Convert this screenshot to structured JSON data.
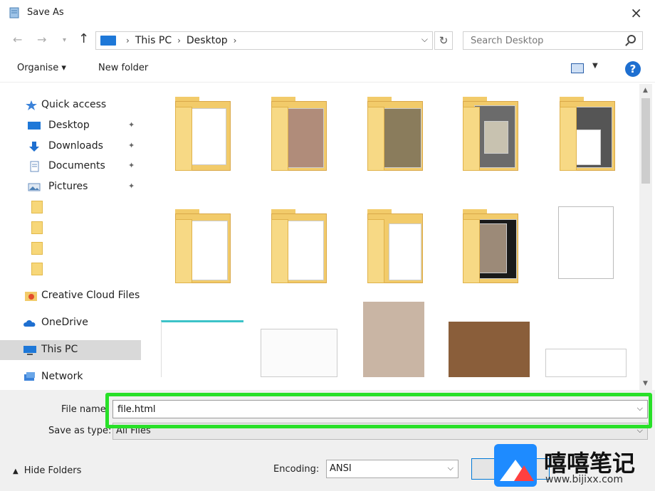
{
  "window": {
    "title": "Save As",
    "close_glyph": "×"
  },
  "nav": {
    "back_glyph": "←",
    "forward_glyph": "→",
    "recent_glyph": "▾",
    "up_glyph": "↑",
    "breadcrumbs": [
      "This PC",
      "Desktop"
    ],
    "crumb_sep": "›",
    "refresh_glyph": "↻",
    "search_placeholder": "Search Desktop"
  },
  "toolbar": {
    "organise_label": "Organise ▾",
    "new_folder_label": "New folder",
    "help_label": "?"
  },
  "sidebar": {
    "quick_access": "Quick access",
    "desktop": "Desktop",
    "downloads": "Downloads",
    "documents": "Documents",
    "pictures": "Pictures",
    "creative_cloud": "Creative Cloud Files",
    "onedrive": "OneDrive",
    "this_pc": "This PC",
    "network": "Network",
    "pin_glyph": "📌"
  },
  "bottom": {
    "file_name_label": "File name:",
    "file_name_value": "file.html",
    "save_type_label": "Save as type:",
    "save_type_value": "All Files",
    "hide_folders_label": "Hide Folders",
    "encoding_label": "Encoding:",
    "encoding_value": "ANSI"
  },
  "watermark": {
    "title": "嘻嘻笔记",
    "url": "www.bijixx.com"
  },
  "colors": {
    "accent": "#0078d7",
    "highlight": "#28e028",
    "folder": "#f2cb6a"
  }
}
